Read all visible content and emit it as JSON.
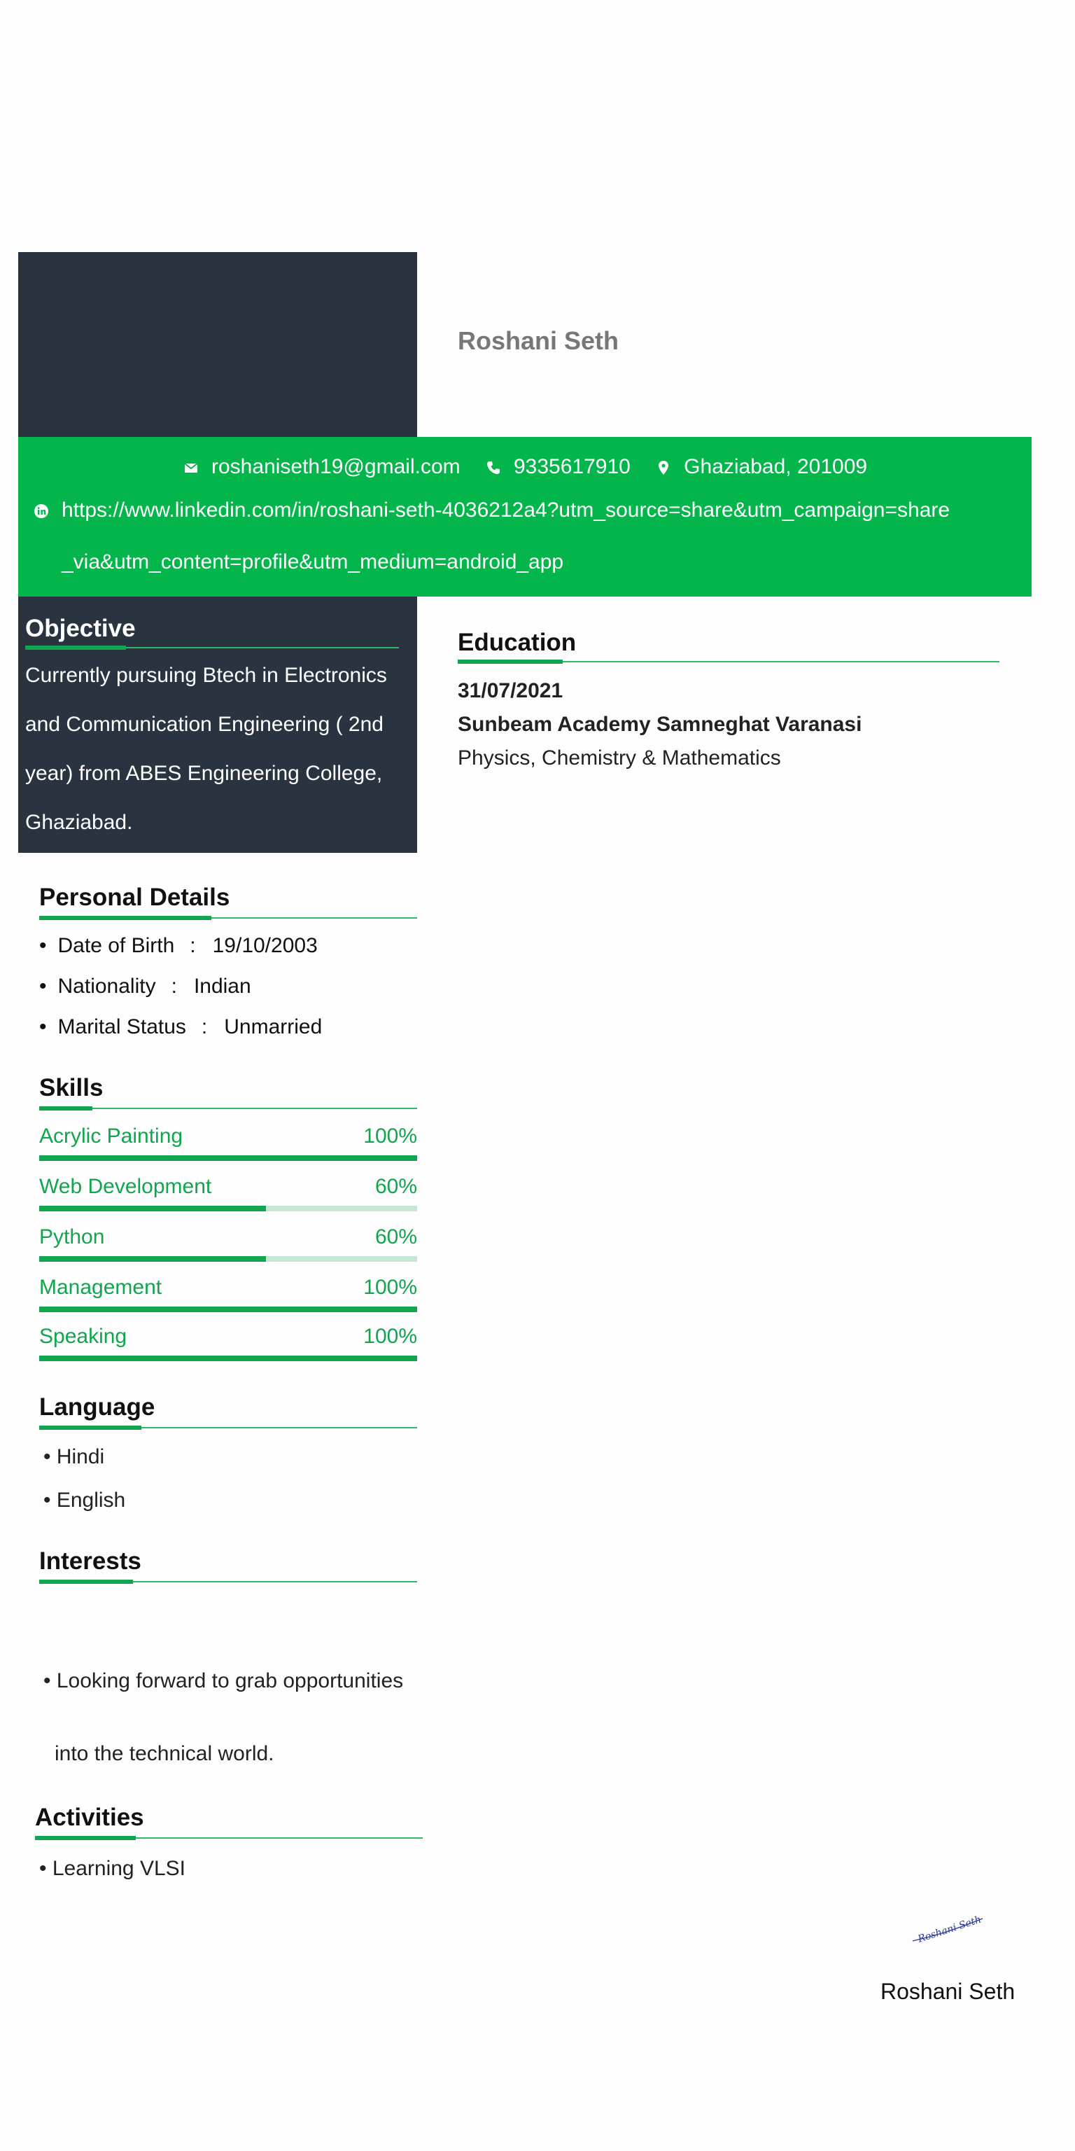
{
  "header": {
    "name": "Roshani Seth"
  },
  "contact": {
    "email": "roshaniseth19@gmail.com",
    "phone": "9335617910",
    "location": "Ghaziabad, 201009",
    "linkedin_line1": "https://www.linkedin.com/in/roshani-seth-4036212a4?utm_source=share&utm_campaign=share",
    "linkedin_line2": "_via&utm_content=profile&utm_medium=android_app"
  },
  "objective": {
    "title": "Objective",
    "lines": [
      "Currently pursuing Btech in Electronics",
      "and Communication Engineering ( 2nd",
      "year) from ABES Engineering College,",
      "Ghaziabad."
    ]
  },
  "education": {
    "title": "Education",
    "date": "31/07/2021",
    "school": "Sunbeam Academy Samneghat Varanasi",
    "subjects": "Physics, Chemistry & Mathematics"
  },
  "personal_details": {
    "title": "Personal Details",
    "rows": [
      {
        "label": "Date of Birth",
        "sep": ":",
        "value": "19/10/2003"
      },
      {
        "label": "Nationality",
        "sep": ":",
        "value": "Indian"
      },
      {
        "label": "Marital Status",
        "sep": ":",
        "value": "Unmarried"
      }
    ]
  },
  "skills": {
    "title": "Skills",
    "items": [
      {
        "name": "Acrylic Painting",
        "percent_label": "100%",
        "level": 1.0
      },
      {
        "name": "Web Development",
        "percent_label": "60%",
        "level": 0.6
      },
      {
        "name": "Python",
        "percent_label": "60%",
        "level": 0.6
      },
      {
        "name": "Management",
        "percent_label": "100%",
        "level": 1.0
      },
      {
        "name": "Speaking",
        "percent_label": "100%",
        "level": 1.0
      }
    ]
  },
  "language": {
    "title": "Language",
    "items": [
      "Hindi",
      "English"
    ]
  },
  "interests": {
    "title": "Interests",
    "lines": [
      "Looking forward to grab opportunities",
      "into the technical world."
    ]
  },
  "activities": {
    "title": "Activities",
    "items": [
      "Learning VLSI"
    ]
  },
  "signature": {
    "handwritten": "Roshani Seth",
    "name": "Roshani Seth"
  },
  "colors": {
    "dark": "#2a3440",
    "green": "#03b54b",
    "accent": "#12a54f"
  },
  "icons": [
    "mail-icon",
    "phone-icon",
    "location-pin-icon",
    "linkedin-icon"
  ]
}
